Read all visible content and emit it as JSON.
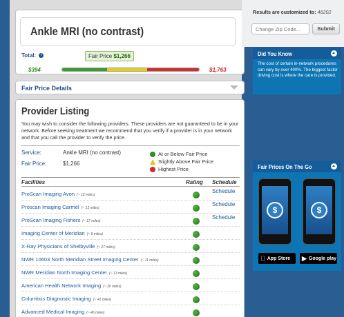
{
  "procedure": {
    "title": "Ankle MRI (no contrast)",
    "total_label": "Total:",
    "fair_price_prefix": "Fair Price",
    "fair_price": "$1,266",
    "low_price": "$394",
    "high_price": "$1,763"
  },
  "fair_price_details": {
    "label": "Fair Price Details"
  },
  "provider_listing": {
    "title": "Provider Listing",
    "disclaimer": "You may wish to consider the following providers. These providers are not guaranteed to be in your network. Before seeking treatment we recommend that you verify if a provider is in your network and that you call the provider to verify the price.",
    "service_label": "Service:",
    "service_value": "Ankle MRI (no contrast)",
    "fair_price_label": "Fair Price:",
    "fair_price_value": "$1,266",
    "legend": {
      "green": "At or Below Fair Price",
      "yellow": "Slightly Above Fair Price",
      "red": "Highest Price"
    },
    "columns": {
      "facilities": "Facilities",
      "rating": "Rating",
      "schedule": "Schedule"
    },
    "facilities": [
      {
        "name": "ProScan Imaging Avon",
        "distance": "(~ 12 miles)",
        "schedule": "Schedule"
      },
      {
        "name": "Proscan Imaging Carmel",
        "distance": "(~ 13 miles)",
        "schedule": "Schedule"
      },
      {
        "name": "ProScan Imaging Fishers",
        "distance": "(~ 17 miles)",
        "schedule": "Schedule"
      },
      {
        "name": "Imaging Center of Meridian",
        "distance": "(~ 8 miles)",
        "schedule": ""
      },
      {
        "name": "X-Ray Physicians of Shelbyville",
        "distance": "(~ 27 miles)",
        "schedule": ""
      },
      {
        "name": "NWR 10603 North Meridian Street Imaging Center",
        "distance": "(~ 11 miles)",
        "schedule": ""
      },
      {
        "name": "NWR Meridian North Imaging Center",
        "distance": "(~ 13 miles)",
        "schedule": ""
      },
      {
        "name": "American Health Network Imaging",
        "distance": "(~ 20 miles)",
        "schedule": ""
      },
      {
        "name": "Columbus Diagnostic Imaging",
        "distance": "(~ 41 miles)",
        "schedule": ""
      },
      {
        "name": "Advanced Medical Imaging",
        "distance": "(~ 46 miles)",
        "schedule": ""
      }
    ]
  },
  "sidebar": {
    "results_text": "Results are customized to:",
    "zip_value": "46202",
    "zip_placeholder": "Change Zip Code...",
    "submit_label": "Submit",
    "did_you_know_title": "Did You Know",
    "did_you_know_body": "The cost of certain in-network procedures can vary by over 400%. The biggest factor driving cost is where the care is provided.",
    "on_the_go_title": "Fair Prices On The Go",
    "app_store_label": "App Store",
    "google_play_label": "Google play"
  },
  "colors": {
    "accent_blue": "#1f4f8d",
    "panel_blue": "#0e75b4",
    "good_green": "#2f8f25",
    "warn_yellow": "#e8c414",
    "bad_red": "#d52a2a"
  }
}
